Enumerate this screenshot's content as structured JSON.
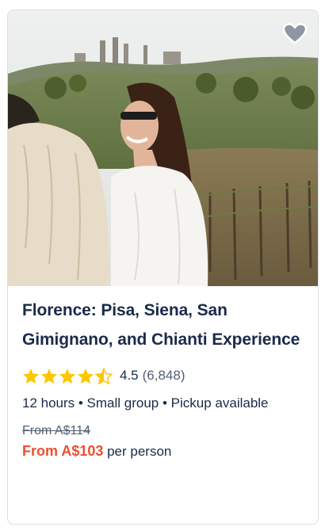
{
  "card": {
    "image_alt": "Woman smiling in a Tuscan vineyard with San Gimignano towers in the background",
    "wishlist_icon": "heart-icon",
    "title": "Florence: Pisa, Siena, San Gimignano, and Chianti Experience",
    "rating": {
      "value": "4.5",
      "stars": 4.5,
      "count": "(6,848)"
    },
    "details": "12 hours • Small group • Pickup available",
    "price": {
      "original": "From A$114",
      "current": "From A$103",
      "suffix": " per person"
    },
    "colors": {
      "accent": "#eb4f30",
      "star": "#fdc700",
      "text": "#1a2b49"
    }
  }
}
